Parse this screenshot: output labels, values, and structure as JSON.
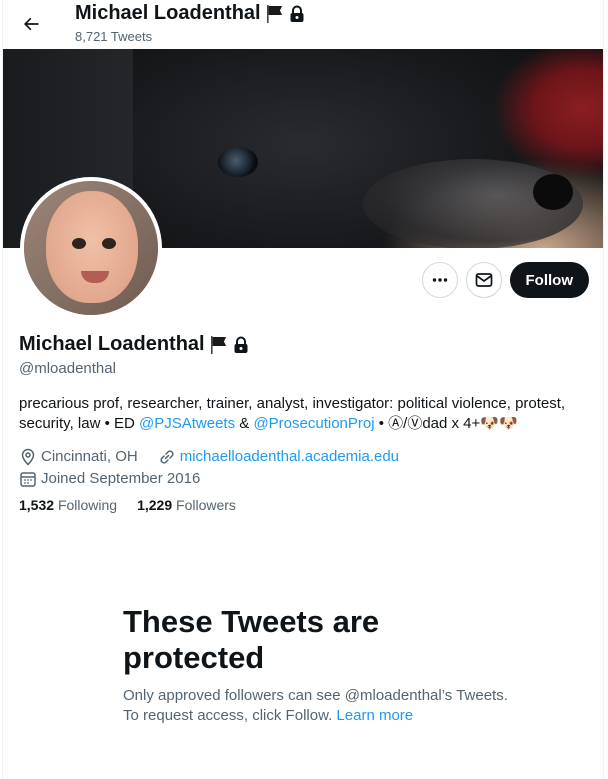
{
  "header": {
    "name": "Michael Loadenthal",
    "tweet_count": "8,721 Tweets"
  },
  "profile": {
    "name": "Michael Loadenthal",
    "handle": "@mloadenthal",
    "bio_text_1": "precarious prof, researcher, trainer, analyst, investigator: political violence, protest, security, law • ED ",
    "bio_link_1": "@PJSAtweets",
    "bio_text_2": " & ",
    "bio_link_2": "@ProsecutionProj",
    "bio_text_3": " • Ⓐ/Ⓥdad x 4+🐶🐶",
    "location": "Cincinnati, OH",
    "website": "michaelloadenthal.academia.edu",
    "joined": "Joined September 2016",
    "following_count": "1,532",
    "following_label": "Following",
    "followers_count": "1,229",
    "followers_label": "Followers"
  },
  "actions": {
    "follow_label": "Follow"
  },
  "protected": {
    "title": "These Tweets are protected",
    "desc": "Only approved followers can see @mloadenthal’s Tweets. To request access, click Follow.",
    "learn_more": "Learn more"
  },
  "icons": {
    "back": "arrow-left-icon",
    "flag": "black-flag-icon",
    "lock": "lock-icon",
    "more": "more-icon",
    "message": "envelope-icon",
    "location": "location-pin-icon",
    "link": "link-icon",
    "calendar": "calendar-icon"
  },
  "colors": {
    "link": "#1d9bf0",
    "text": "#0f1419",
    "secondary": "#536471",
    "follow_bg": "#0f1419"
  }
}
